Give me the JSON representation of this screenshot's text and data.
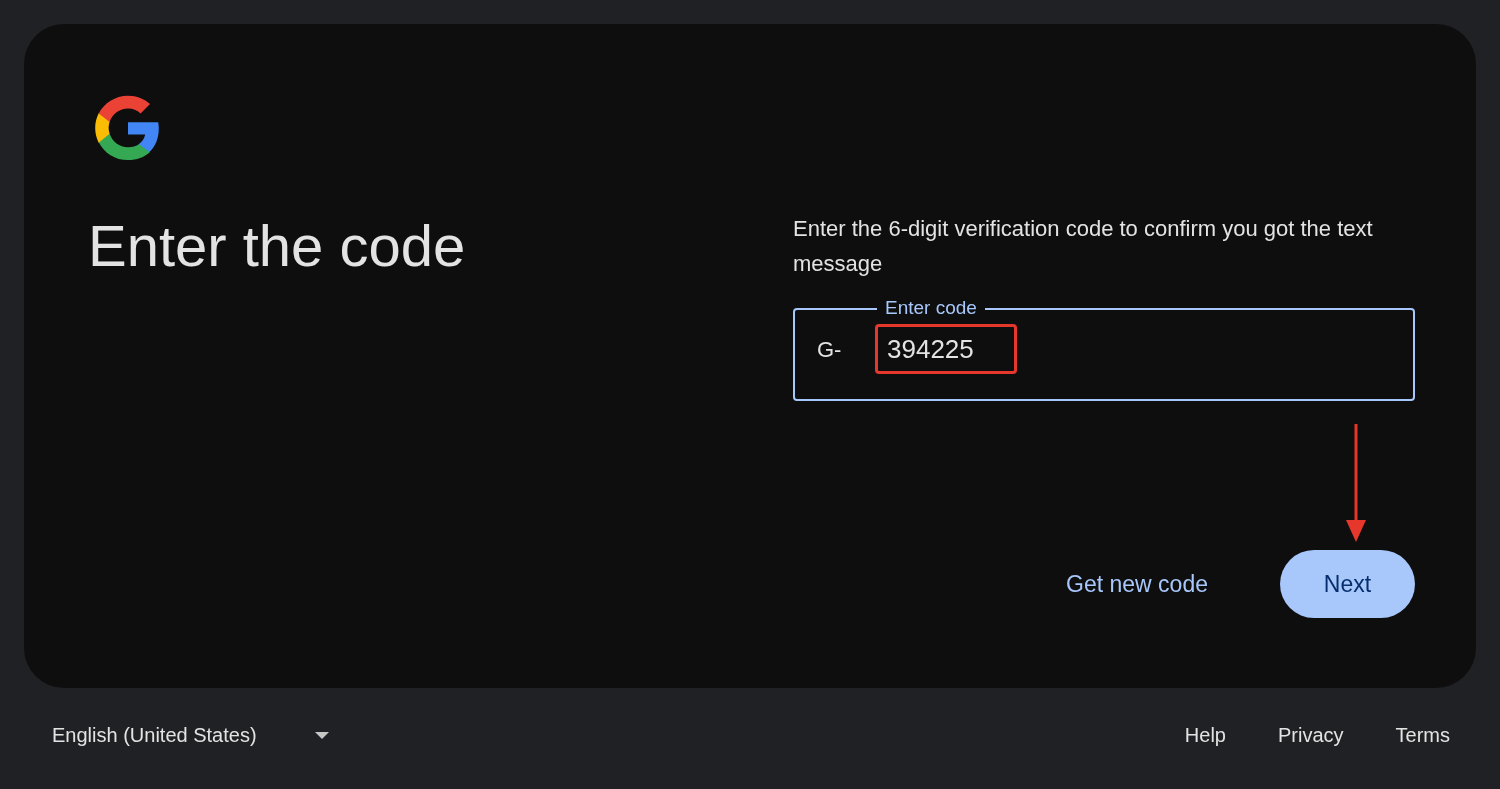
{
  "title": "Enter the code",
  "instructions": "Enter the 6-digit verification code to confirm you got the text message",
  "code_field": {
    "label": "Enter code",
    "prefix": "G-",
    "value": "394225",
    "focused": true
  },
  "annotations": {
    "highlight_value": true,
    "arrow_to_next": true
  },
  "actions": [
    {
      "label": "Get new code",
      "kind": "text"
    },
    {
      "label": "Next",
      "kind": "filled"
    }
  ],
  "footer": {
    "language": "English (United States)",
    "links": [
      "Help",
      "Privacy",
      "Terms"
    ]
  }
}
